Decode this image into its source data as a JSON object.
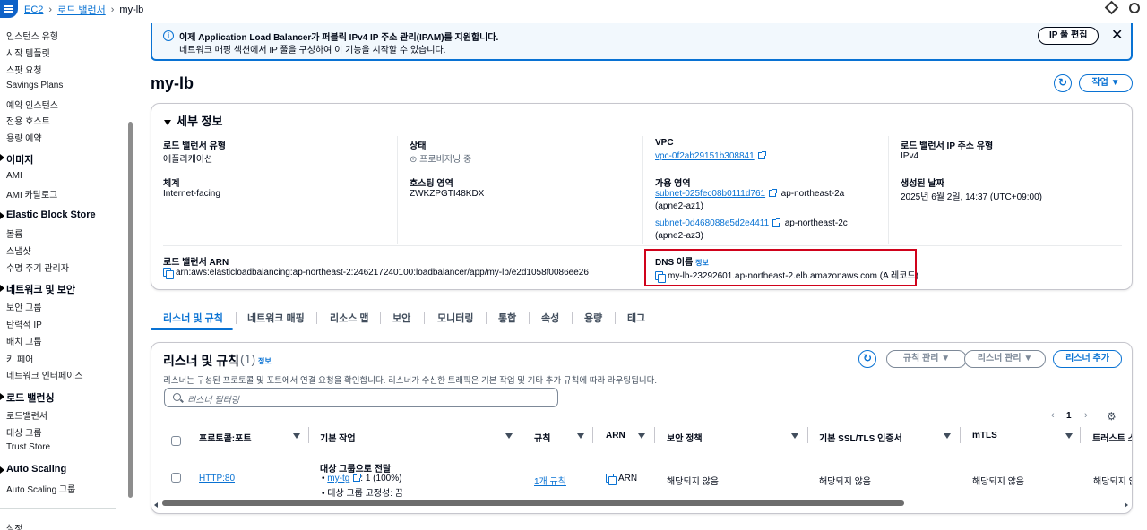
{
  "topbar": {
    "breadcrumb": [
      "EC2",
      "로드 밸런서",
      "my-lb"
    ]
  },
  "sidebar": {
    "items_top": [
      "인스턴스 유형",
      "시작 템플릿",
      "스팟 요청",
      "Savings Plans",
      "예약 인스턴스",
      "전용 호스트",
      "용량 예약"
    ],
    "sec_images": "이미지",
    "items_images": [
      "AMI",
      "AMI 카탈로그"
    ],
    "sec_ebs": "Elastic Block Store",
    "items_ebs": [
      "볼륨",
      "스냅샷",
      "수명 주기 관리자"
    ],
    "sec_network": "네트워크 및 보안",
    "items_network": [
      "보안 그룹",
      "탄력적 IP",
      "배치 그룹",
      "키 페어",
      "네트워크 인터페이스"
    ],
    "sec_lb": "로드 밸런싱",
    "items_lb": [
      "로드밸런서",
      "대상 그룹",
      "Trust Store"
    ],
    "sec_as": "Auto Scaling",
    "items_as": [
      "Auto Scaling 그룹"
    ],
    "bottom": "설정"
  },
  "banner": {
    "line1": "이제 Application Load Balancer가 퍼블릭 IPv4 IP 주소 관리(IPAM)를 지원합니다.",
    "line2": "네트워크 매핑 섹션에서 IP 풀을 구성하여 이 기능을 시작할 수 있습니다.",
    "button": "IP 풀 편집",
    "close": "✕"
  },
  "page": {
    "title": "my-lb",
    "actions_button": "작업 ▼"
  },
  "details": {
    "title": "세부 정보",
    "lb_type_label": "로드 밸런서 유형",
    "lb_type_value": "애플리케이션",
    "state_label": "상태",
    "state_value": "프로비저닝 중",
    "vpc_label": "VPC",
    "vpc_value": "vpc-0f2ab29151b308841",
    "ip_type_label": "로드 밸런서 IP 주소 유형",
    "ip_type_value": "IPv4",
    "scheme_label": "체계",
    "scheme_value": "Internet-facing",
    "hosted_zone_label": "호스팅 영역",
    "hosted_zone_value": "ZWKZPGTI48KDX",
    "az_label": "가용 영역",
    "az1_subnet": "subnet-025fec08b0111d761",
    "az1_region": "ap-northeast-2a",
    "az1_zone": "(apne2-az1)",
    "az2_subnet": "subnet-0d468088e5d2e4411",
    "az2_region": "ap-northeast-2c",
    "az2_zone": "(apne2-az3)",
    "created_label": "생성된 날짜",
    "created_value": "2025년 6월 2일, 14:37 (UTC+09:00)",
    "arn_label": "로드 밸런서 ARN",
    "arn_value": "arn:aws:elasticloadbalancing:ap-northeast-2:246217240100:loadbalancer/app/my-lb/e2d1058f0086ee26",
    "dns_label": "DNS 이름",
    "dns_info": "정보",
    "dns_value": "my-lb-23292601.ap-northeast-2.elb.amazonaws.com (A 레코드)"
  },
  "tabs": [
    "리스너 및 규칙",
    "네트워크 매핑",
    "리소스 맵",
    "보안",
    "모니터링",
    "통합",
    "속성",
    "용량",
    "태그"
  ],
  "listeners": {
    "title": "리스너 및 규칙",
    "count": "(1)",
    "info": "정보",
    "description": "리스너는 구성된 프로토콜 및 포트에서 연결 요청을 확인합니다. 리스너가 수신한 트래픽은 기본 작업 및 기타 추가 규칙에 따라 라우팅됩니다.",
    "manage_rules": "규칙 관리 ▼",
    "manage_listener": "리스너 관리 ▼",
    "add_listener": "리스너 추가",
    "search_placeholder": "리스너 필터링",
    "page_number": "1",
    "columns": [
      "프로토콜:포트",
      "기본 작업",
      "규칙",
      "ARN",
      "보안 정책",
      "기본 SSL/TLS 인증서",
      "mTLS",
      "트러스트 스토어"
    ],
    "row": {
      "protocol": "HTTP:80",
      "action_title": "대상 그룹으로 전달",
      "action_tg": "my-tg",
      "action_weight": ": 1 (100%)",
      "action_sticky": "대상 그룹 고정성: 끔",
      "rules": "1개 규칙",
      "arn": "ARN",
      "security_policy": "해당되지 않음",
      "ssl_cert": "해당되지 않음",
      "mtls": "해당되지 않음",
      "trust_store": "해당되지 않"
    }
  }
}
